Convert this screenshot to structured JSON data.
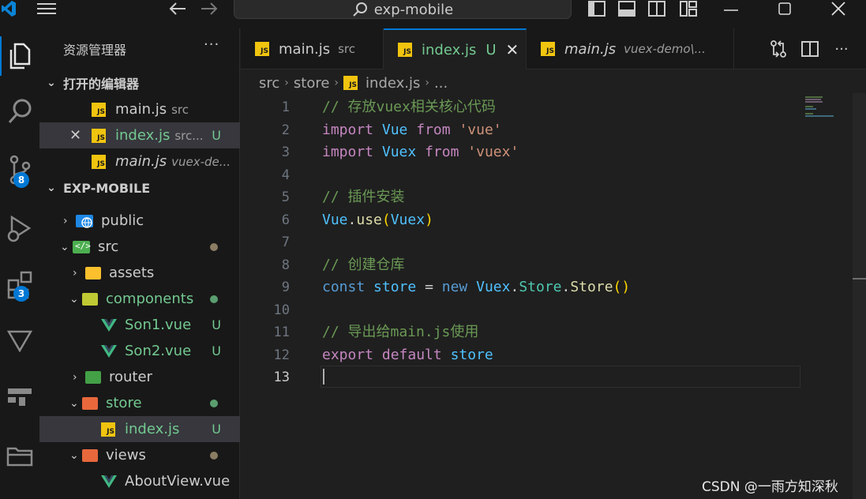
{
  "titlebar": {
    "search_text": "exp-mobile"
  },
  "activity": {
    "scm_badge": "8",
    "extensions_badge": "3"
  },
  "sidebar": {
    "title": "资源管理器",
    "more": "···",
    "open_editors": {
      "header": "打开的编辑器",
      "items": [
        {
          "name": "main.js",
          "desc": "src",
          "status": ""
        },
        {
          "name": "index.js",
          "desc": "src...",
          "status": "U"
        },
        {
          "name": "main.js",
          "desc": "vuex-de...",
          "status": ""
        }
      ]
    },
    "project": {
      "header": "EXP-MOBILE",
      "items": [
        {
          "name": "public",
          "status": ""
        },
        {
          "name": "src",
          "status": "●"
        },
        {
          "name": "assets",
          "status": ""
        },
        {
          "name": "components",
          "status": "●"
        },
        {
          "name": "Son1.vue",
          "status": "U"
        },
        {
          "name": "Son2.vue",
          "status": "U"
        },
        {
          "name": "router",
          "status": ""
        },
        {
          "name": "store",
          "status": "●"
        },
        {
          "name": "index.js",
          "status": "U"
        },
        {
          "name": "views",
          "status": "●"
        },
        {
          "name": "AboutView.vue",
          "status": ""
        }
      ]
    }
  },
  "tabs": [
    {
      "name": "main.js",
      "desc": "src",
      "status": ""
    },
    {
      "name": "index.js",
      "desc": "",
      "status": "U"
    },
    {
      "name": "main.js",
      "desc": "vuex-demo\\..."
    }
  ],
  "breadcrumb": {
    "part1": "src",
    "part2": "store",
    "part3": "index.js",
    "part4": "..."
  },
  "editor": {
    "line_numbers": [
      "1",
      "2",
      "3",
      "4",
      "5",
      "6",
      "7",
      "8",
      "9",
      "10",
      "11",
      "12",
      "13"
    ],
    "code": {
      "l1": "// 存放vuex相关核心代码",
      "l2": [
        "import",
        "Vue",
        "from",
        "'vue'"
      ],
      "l3": [
        "import",
        "Vuex",
        "from",
        "'vuex'"
      ],
      "l5": "// 插件安装",
      "l6": [
        "Vue",
        ".",
        "use",
        "(",
        "Vuex",
        ")"
      ],
      "l8": "// 创建仓库",
      "l9": [
        "const",
        "store",
        "=",
        "new",
        "Vuex",
        ".",
        "Store",
        ".",
        "Store",
        "()"
      ],
      "l11": "// 导出给main.js使用",
      "l12": [
        "export",
        "default",
        "store"
      ]
    }
  },
  "watermark": "CSDN @一雨方知深秋",
  "colors": {
    "accent": "#0078d4",
    "untracked": "#73c991",
    "js_icon": "#f1c40f",
    "vue_icon": "#41b883"
  }
}
